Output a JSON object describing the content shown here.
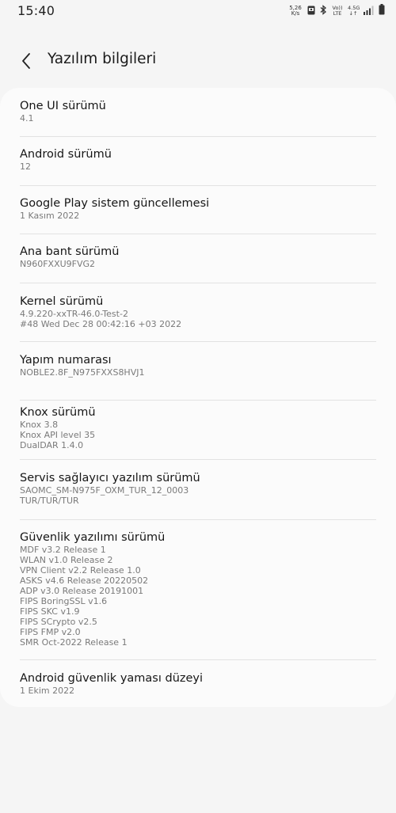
{
  "status_bar": {
    "time": "15:40",
    "speed_value": "5,26",
    "speed_unit": "K/s",
    "volte": "Vo))",
    "lte": "LTE",
    "network_4_5g": "4.5G",
    "network_arrows": "↓↑",
    "icons": [
      "speed-indicator",
      "screenshot-icon",
      "bluetooth-icon",
      "volte-icon",
      "network-icon",
      "signal-icon",
      "battery-icon"
    ]
  },
  "header": {
    "title": "Yazılım bilgileri",
    "back_icon": "chevron-left-icon"
  },
  "items": [
    {
      "title": "One UI sürümü",
      "values": [
        "4.1"
      ]
    },
    {
      "title": "Android sürümü",
      "values": [
        "12"
      ]
    },
    {
      "title": "Google Play sistem güncellemesi",
      "values": [
        "1 Kasım 2022"
      ]
    },
    {
      "title": "Ana bant sürümü",
      "values": [
        "N960FXXU9FVG2"
      ]
    },
    {
      "title": "Kernel sürümü",
      "values": [
        "4.9.220-xxTR-46.0-Test-2",
        "#48 Wed Dec 28 00:42:16 +03 2022"
      ]
    },
    {
      "title": "Yapım numarası",
      "values": [
        "NOBLE2.8F_N975FXXS8HVJ1"
      ]
    },
    {
      "title": "Knox sürümü",
      "values": [
        "Knox 3.8",
        "Knox API level 35",
        "DualDAR 1.4.0"
      ]
    },
    {
      "title": "Servis sağlayıcı yazılım sürümü",
      "values": [
        "SAOMC_SM-N975F_OXM_TUR_12_0003",
        "TUR/TUR/TUR"
      ]
    },
    {
      "title": "Güvenlik yazılımı sürümü",
      "values": [
        "MDF v3.2 Release 1",
        "WLAN v1.0 Release 2",
        "VPN Client v2.2 Release 1.0",
        "ASKS v4.6 Release 20220502",
        "ADP v3.0 Release 20191001",
        "FIPS BoringSSL v1.6",
        "FIPS SKC v1.9",
        "FIPS SCrypto v2.5",
        "FIPS FMP v2.0",
        "SMR Oct-2022 Release 1"
      ]
    },
    {
      "title": "Android güvenlik yaması düzeyi",
      "values": [
        "1 Ekim 2022"
      ]
    }
  ],
  "colors": {
    "background": "#f5f5f5",
    "card": "#fbfbfb",
    "title_text": "#161616",
    "secondary_text": "#7a7a7a",
    "divider": "#e2e2e2"
  }
}
